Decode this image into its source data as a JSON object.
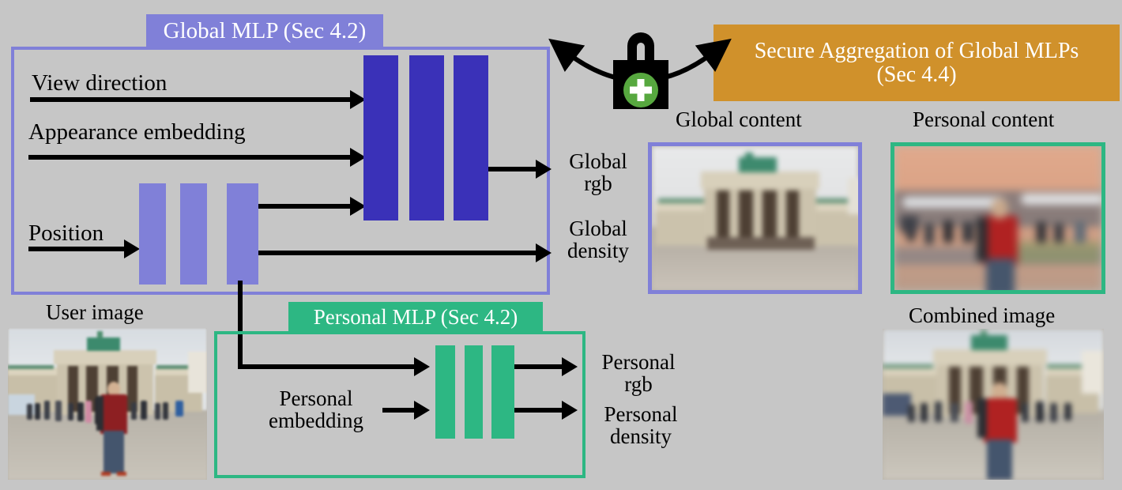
{
  "diagram": {
    "title_global_mlp": "Global MLP (Sec 4.2)",
    "title_personal_mlp": "Personal MLP (Sec 4.2)",
    "secure_aggregation": {
      "line1": "Secure Aggregation of Global MLPs",
      "line2": "(Sec 4.4)"
    },
    "inputs": {
      "view_direction": "View direction",
      "appearance_embedding": "Appearance embedding",
      "position": "Position",
      "personal_embedding": "Personal\nembedding",
      "personal_embedding_line1": "Personal",
      "personal_embedding_line2": "embedding"
    },
    "outputs": {
      "global_rgb_line1": "Global",
      "global_rgb_line2": "rgb",
      "global_density_line1": "Global",
      "global_density_line2": "density",
      "personal_rgb_line1": "Personal",
      "personal_rgb_line2": "rgb",
      "personal_density_line1": "Personal",
      "personal_density_line2": "density"
    },
    "captions": {
      "global_content": "Global content",
      "personal_content": "Personal content",
      "user_image": "User image",
      "combined_image": "Combined image"
    },
    "icons": {
      "lock": "lock-with-plus-icon"
    },
    "colors": {
      "background": "#c6c6c6",
      "global_purple": "#8080d8",
      "global_mlp_bar_dark": "#3a31b8",
      "personal_green": "#2db783",
      "secure_agg_orange": "#d0912b",
      "lock_body": "#000000",
      "lock_plus_circle": "#57a83f",
      "text": "#000000",
      "banner_text": "#ffffff"
    },
    "mlp_structure": {
      "position_encoder_bars": 3,
      "global_trunk_bars": 3,
      "personal_bars": 3
    }
  }
}
